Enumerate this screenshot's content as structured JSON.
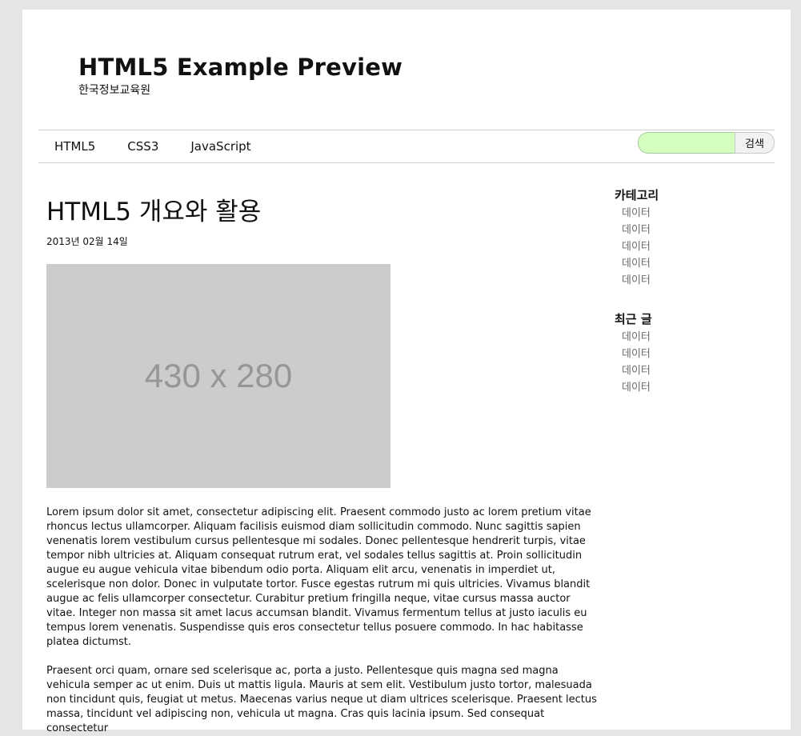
{
  "header": {
    "title": "HTML5 Example Preview",
    "subtitle": "한국정보교육원"
  },
  "nav": {
    "items": [
      "HTML5",
      "CSS3",
      "JavaScript"
    ]
  },
  "search": {
    "value": "",
    "button_label": "검색"
  },
  "article": {
    "title": "HTML5 개요와 활용",
    "date": "2013년 02월 14일",
    "image_label": "430 x 280",
    "paragraphs": [
      "Lorem ipsum dolor sit amet, consectetur adipiscing elit. Praesent commodo justo ac lorem pretium vitae rhoncus lectus ullamcorper. Aliquam facilisis euismod diam sollicitudin commodo. Nunc sagittis sapien venenatis lorem vestibulum cursus pellentesque mi sodales. Donec pellentesque hendrerit turpis, vitae tempor nibh ultricies at. Aliquam consequat rutrum erat, vel sodales tellus sagittis at. Proin sollicitudin augue eu augue vehicula vitae bibendum odio porta. Aliquam elit arcu, venenatis in imperdiet ut, scelerisque non dolor. Donec in vulputate tortor. Fusce egestas rutrum mi quis ultricies. Vivamus blandit augue ac felis ullamcorper consectetur. Curabitur pretium fringilla neque, vitae cursus massa auctor vitae. Integer non massa sit amet lacus accumsan blandit. Vivamus fermentum tellus at justo iaculis eu tempus lorem venenatis. Suspendisse quis eros consectetur tellus posuere commodo. In hac habitasse platea dictumst.",
      "Praesent orci quam, ornare sed scelerisque ac, porta a justo. Pellentesque quis magna sed magna vehicula semper ac ut enim. Duis ut mattis ligula. Mauris at sem elit. Vestibulum justo tortor, malesuada non tincidunt quis, feugiat ut metus. Maecenas varius neque ut diam ultrices scelerisque. Praesent lectus massa, tincidunt vel adipiscing non, vehicula ut magna. Cras quis lacinia ipsum. Sed consequat consectetur"
    ]
  },
  "sidebar": {
    "sections": [
      {
        "heading": "카테고리",
        "items": [
          "데이터",
          "데이터",
          "데이터",
          "데이터",
          "데이터"
        ]
      },
      {
        "heading": "최근 글",
        "items": [
          "데이터",
          "데이터",
          "데이터",
          "데이터"
        ]
      }
    ]
  }
}
